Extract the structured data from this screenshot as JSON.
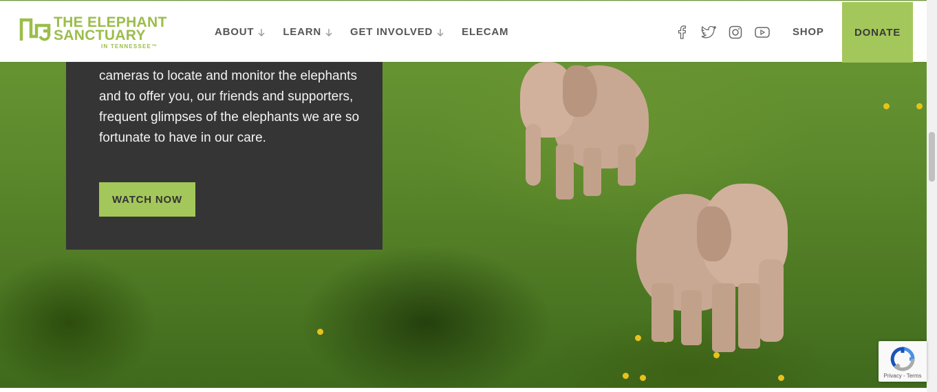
{
  "header": {
    "logo": {
      "line1": "THE ELEPHANT",
      "line2": "SANCTUARY",
      "line3": "IN TENNESSEE™"
    },
    "nav": [
      {
        "label": "ABOUT",
        "has_dropdown": true
      },
      {
        "label": "LEARN",
        "has_dropdown": true
      },
      {
        "label": "GET INVOLVED",
        "has_dropdown": true
      },
      {
        "label": "ELECAM",
        "has_dropdown": false
      }
    ],
    "social_icons": [
      "facebook-icon",
      "twitter-icon",
      "instagram-icon",
      "youtube-icon"
    ],
    "shop_label": "SHOP",
    "donate_label": "DONATE"
  },
  "card": {
    "text": "cameras to locate and monitor the elephants and to offer you, our friends and supporters, frequent glimpses of the elephants we are so fortunate to have in our care.",
    "button_label": "WATCH NOW"
  },
  "recaptcha": {
    "privacy_label": "Privacy",
    "separator": " - ",
    "terms_label": "Terms"
  },
  "colors": {
    "accent_green": "#a3c75a",
    "logo_green": "#9bbd4a",
    "card_background": "#353535",
    "nav_text": "#555555"
  }
}
